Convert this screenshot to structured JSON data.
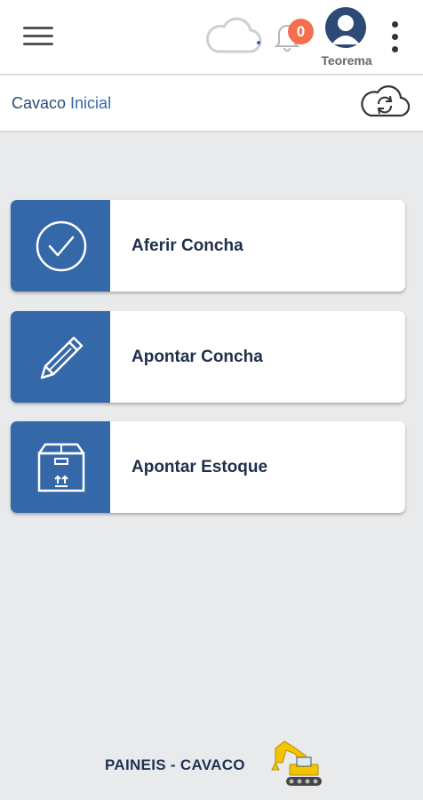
{
  "header": {
    "notification_count": "0",
    "user_name": "Teorema",
    "icons": [
      "menu-icon",
      "cloud-icon",
      "bell-icon",
      "avatar-icon",
      "kebab-icon"
    ]
  },
  "subheader": {
    "app_name": "Cavaco",
    "page_name": "Inicial",
    "sync_icon": "cloud-sync-icon"
  },
  "menu": [
    {
      "label": "Aferir Concha",
      "icon": "check-circle-icon"
    },
    {
      "label": "Apontar Concha",
      "icon": "pencil-icon"
    },
    {
      "label": "Apontar Estoque",
      "icon": "box-icon"
    }
  ],
  "footer": {
    "label": "PAINEIS - CAVACO",
    "icon": "excavator-icon"
  },
  "colors": {
    "primary": "#3468a8",
    "badge": "#f4704c",
    "background": "#e9eaeb",
    "text_dark": "#1f2f4a"
  }
}
